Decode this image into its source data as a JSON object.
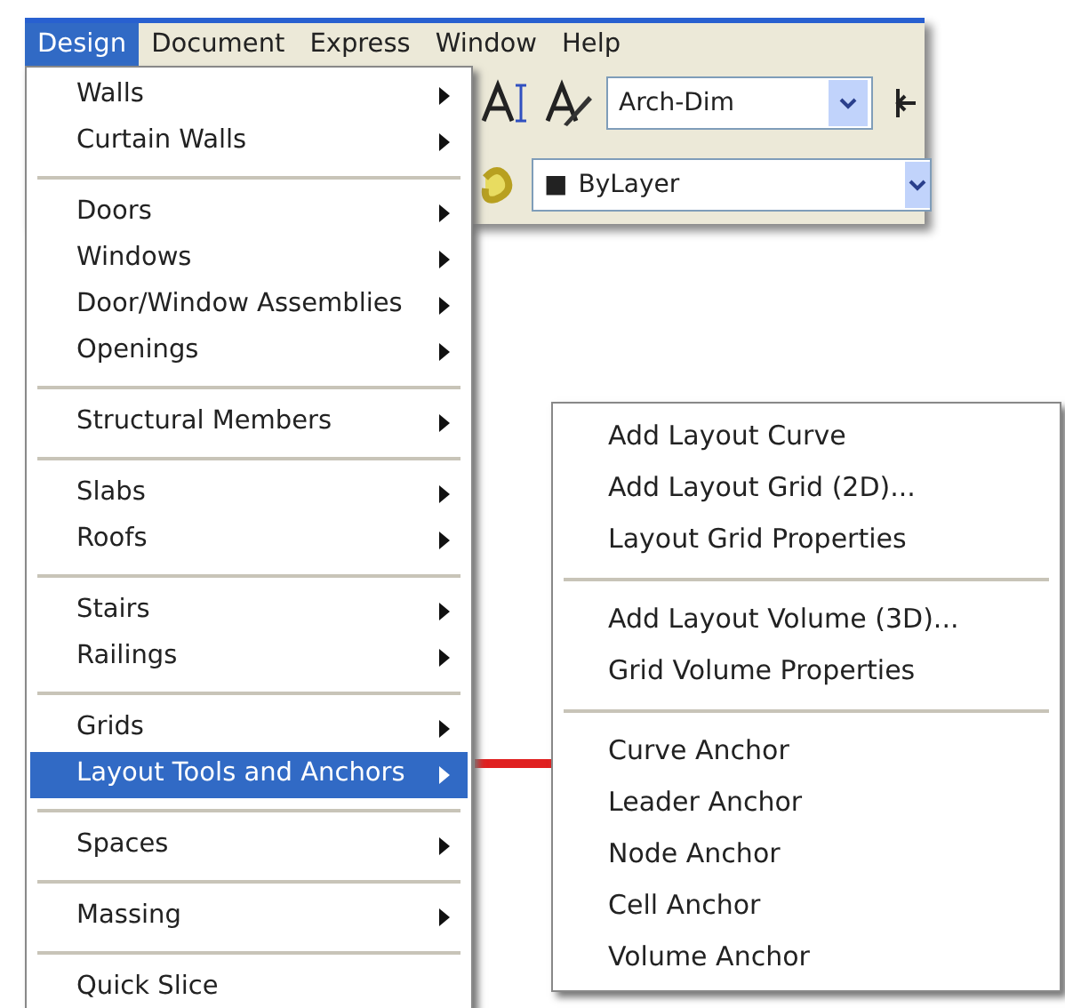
{
  "menu_bar": [
    {
      "label": "Design",
      "selected": true
    },
    {
      "label": "Document",
      "selected": false
    },
    {
      "label": "Express",
      "selected": false
    },
    {
      "label": "Window",
      "selected": false
    },
    {
      "label": "Help",
      "selected": false
    }
  ],
  "toolbar": {
    "style_combo": {
      "value": "Arch-Dim"
    },
    "layer_combo": {
      "swatch": "■",
      "value": "ByLayer"
    }
  },
  "design_menu": [
    [
      {
        "label": "Walls",
        "submenu": true,
        "selected": false
      },
      {
        "label": "Curtain Walls",
        "submenu": true,
        "selected": false
      }
    ],
    [
      {
        "label": "Doors",
        "submenu": true,
        "selected": false
      },
      {
        "label": "Windows",
        "submenu": true,
        "selected": false
      },
      {
        "label": "Door/Window Assemblies",
        "submenu": true,
        "selected": false
      },
      {
        "label": "Openings",
        "submenu": true,
        "selected": false
      }
    ],
    [
      {
        "label": "Structural Members",
        "submenu": true,
        "selected": false
      }
    ],
    [
      {
        "label": "Slabs",
        "submenu": true,
        "selected": false
      },
      {
        "label": "Roofs",
        "submenu": true,
        "selected": false
      }
    ],
    [
      {
        "label": "Stairs",
        "submenu": true,
        "selected": false
      },
      {
        "label": "Railings",
        "submenu": true,
        "selected": false
      }
    ],
    [
      {
        "label": "Grids",
        "submenu": true,
        "selected": false
      },
      {
        "label": "Layout Tools and Anchors",
        "submenu": true,
        "selected": true
      }
    ],
    [
      {
        "label": "Spaces",
        "submenu": true,
        "selected": false
      }
    ],
    [
      {
        "label": "Massing",
        "submenu": true,
        "selected": false
      }
    ],
    [
      {
        "label": "Quick Slice",
        "submenu": false,
        "selected": false
      }
    ]
  ],
  "layout_submenu": [
    [
      "Add Layout Curve",
      "Add Layout Grid (2D)...",
      "Layout Grid Properties"
    ],
    [
      "Add Layout Volume (3D)...",
      "Grid Volume Properties"
    ],
    [
      "Curve Anchor",
      "Leader Anchor",
      "Node Anchor",
      "Cell Anchor",
      "Volume Anchor"
    ]
  ]
}
